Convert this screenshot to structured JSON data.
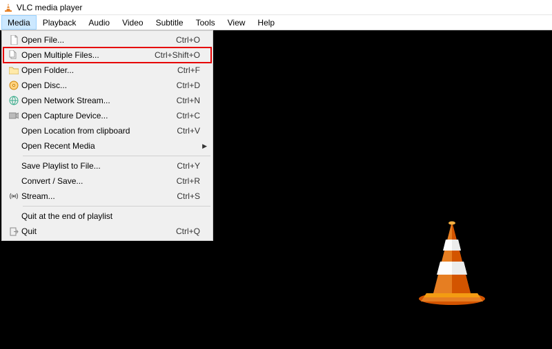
{
  "title": "VLC media player",
  "menubar": [
    "Media",
    "Playback",
    "Audio",
    "Video",
    "Subtitle",
    "Tools",
    "View",
    "Help"
  ],
  "active_menu": "Media",
  "dropdown": {
    "groups": [
      [
        {
          "icon": "file-icon",
          "label": "Open File...",
          "shortcut": "Ctrl+O"
        },
        {
          "icon": "files-icon",
          "label": "Open Multiple Files...",
          "shortcut": "Ctrl+Shift+O",
          "highlight": true
        },
        {
          "icon": "folder-icon",
          "label": "Open Folder...",
          "shortcut": "Ctrl+F"
        },
        {
          "icon": "disc-icon",
          "label": "Open Disc...",
          "shortcut": "Ctrl+D"
        },
        {
          "icon": "network-icon",
          "label": "Open Network Stream...",
          "shortcut": "Ctrl+N"
        },
        {
          "icon": "capture-icon",
          "label": "Open Capture Device...",
          "shortcut": "Ctrl+C"
        },
        {
          "icon": "",
          "label": "Open Location from clipboard",
          "shortcut": "Ctrl+V"
        },
        {
          "icon": "",
          "label": "Open Recent Media",
          "shortcut": "",
          "submenu": true
        }
      ],
      [
        {
          "icon": "",
          "label": "Save Playlist to File...",
          "shortcut": "Ctrl+Y"
        },
        {
          "icon": "",
          "label": "Convert / Save...",
          "shortcut": "Ctrl+R"
        },
        {
          "icon": "stream-icon",
          "label": "Stream...",
          "shortcut": "Ctrl+S"
        }
      ],
      [
        {
          "icon": "",
          "label": "Quit at the end of playlist",
          "shortcut": ""
        },
        {
          "icon": "quit-icon",
          "label": "Quit",
          "shortcut": "Ctrl+Q"
        }
      ]
    ]
  }
}
